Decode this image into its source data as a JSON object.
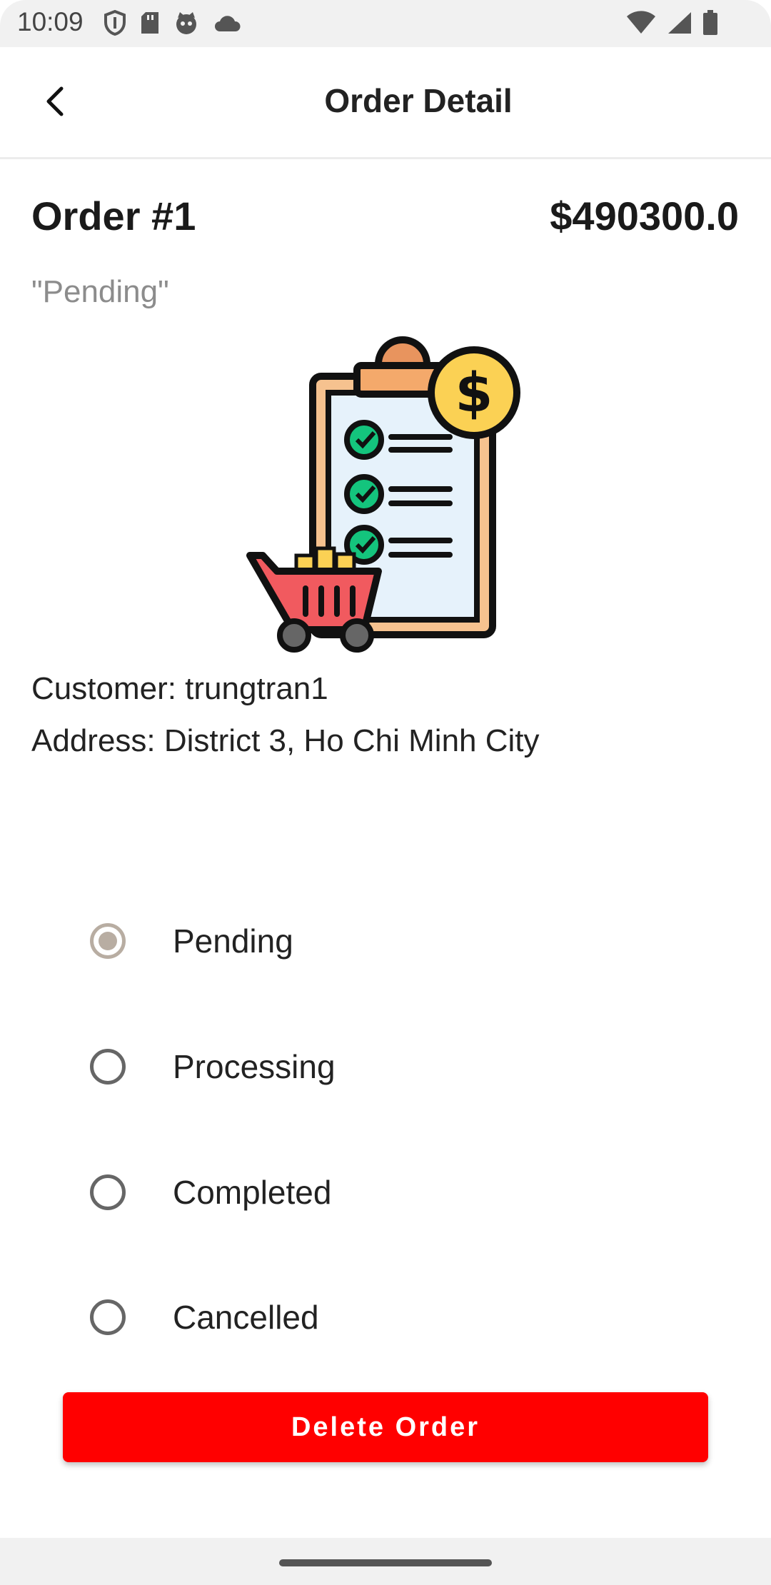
{
  "status_bar": {
    "time": "10:09"
  },
  "app_bar": {
    "title": "Order Detail"
  },
  "order": {
    "number": "Order #1",
    "total": "$490300.0",
    "status": "\"Pending\"",
    "customer": "Customer: trungtran1",
    "address": "Address: District 3, Ho Chi Minh City"
  },
  "status_options": [
    {
      "label": "Pending",
      "selected": true
    },
    {
      "label": "Processing",
      "selected": false
    },
    {
      "label": "Completed",
      "selected": false
    },
    {
      "label": "Cancelled",
      "selected": false
    }
  ],
  "delete_button": {
    "label": "Delete Order"
  },
  "colors": {
    "accent_red": "#ff0000",
    "radio_selected": "#b8ada2"
  }
}
